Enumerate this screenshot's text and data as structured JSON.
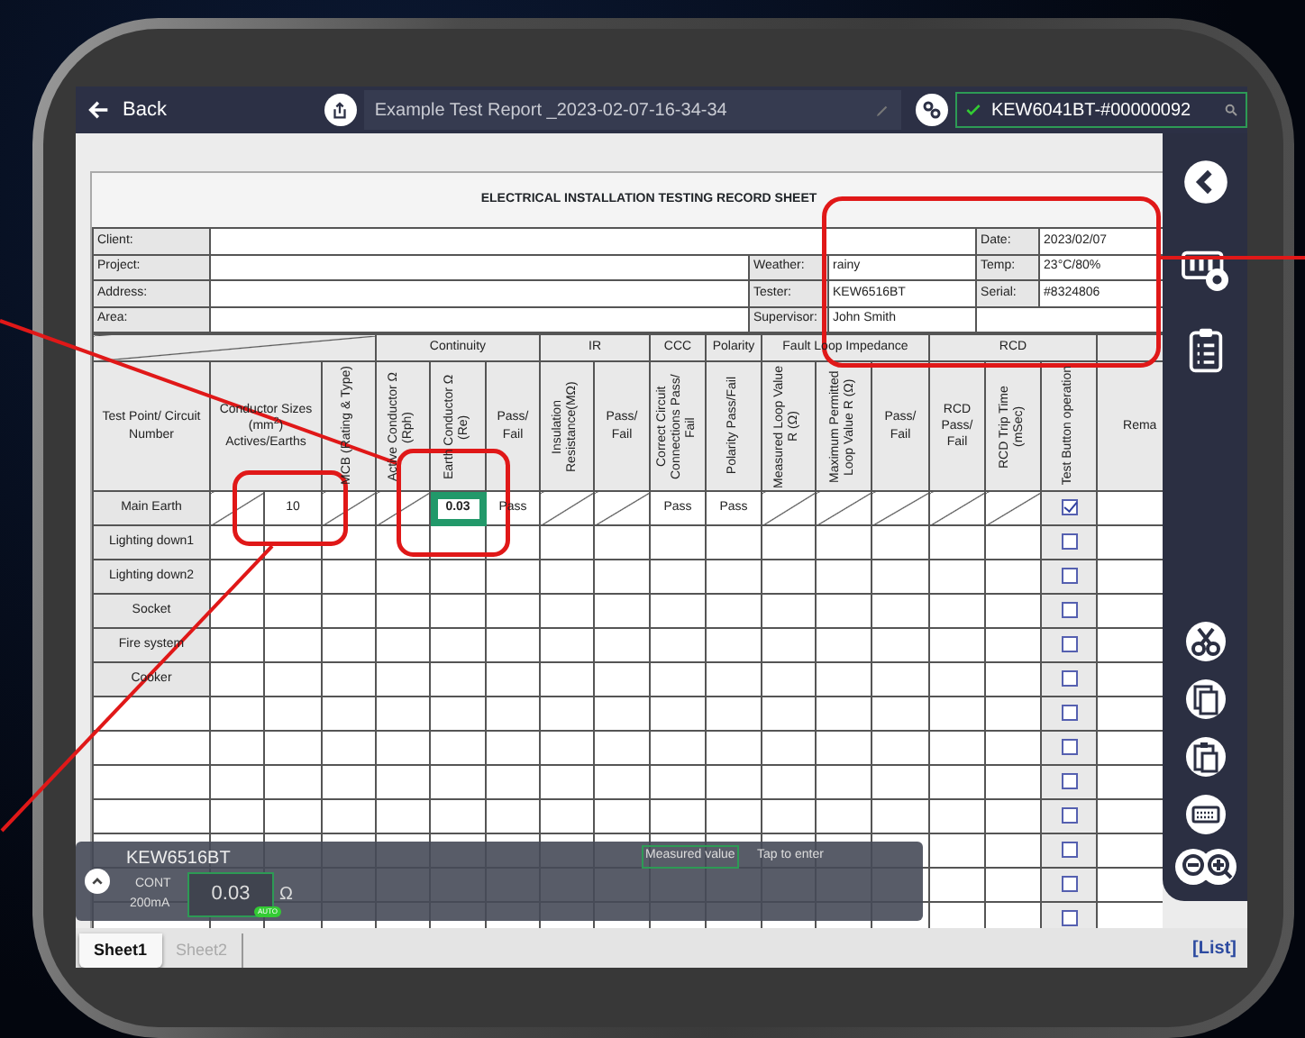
{
  "top_bar": {
    "back": "Back",
    "report_title": "Example Test Report _2023-02-07-16-34-34",
    "device": "KEW6041BT-#00000092",
    "device_connected": true
  },
  "sheet": {
    "title": "ELECTRICAL INSTALLATION TESTING RECORD SHEET",
    "info_rows": [
      [
        {
          "kind": "label",
          "text": "Client:"
        },
        {
          "kind": "blank"
        },
        {
          "kind": "blank"
        },
        {
          "kind": "blank"
        },
        {
          "kind": "label",
          "text": "Date:"
        },
        {
          "kind": "value",
          "text": "2023/02/07"
        }
      ],
      [
        {
          "kind": "label",
          "text": "Project:"
        },
        {
          "kind": "blank"
        },
        {
          "kind": "label",
          "text": "Weather:"
        },
        {
          "kind": "value",
          "text": "rainy"
        },
        {
          "kind": "label",
          "text": "Temp:"
        },
        {
          "kind": "value",
          "text": "23°C/80%"
        }
      ],
      [
        {
          "kind": "label",
          "text": "Address:"
        },
        {
          "kind": "blank"
        },
        {
          "kind": "label",
          "text": "Tester:"
        },
        {
          "kind": "value",
          "text": "KEW6516BT"
        },
        {
          "kind": "label",
          "text": "Serial:"
        },
        {
          "kind": "value",
          "text": "#8324806"
        }
      ],
      [
        {
          "kind": "label",
          "text": "Area:"
        },
        {
          "kind": "blank"
        },
        {
          "kind": "label",
          "text": "Supervisor:"
        },
        {
          "kind": "value",
          "text": "John Smith"
        },
        {
          "kind": "blank"
        },
        {
          "kind": "blank"
        }
      ]
    ],
    "column_groups": [
      {
        "columns": [
          {
            "label": "Test Point/ Circuit Number",
            "vertical": false
          },
          {
            "label": "Conductor Sizes (mm$^{2}$) Actives/Earths",
            "vertical": false,
            "kind": "pair"
          },
          {
            "label": "MCB (Rating & Type)",
            "vertical": true
          }
        ]
      },
      {
        "label": "Continuity",
        "columns": [
          {
            "label": "Active Conductor Ω (Rph)",
            "vertical": true
          },
          {
            "label": "Earth Conductor Ω (Re)",
            "vertical": true
          },
          {
            "label": "Pass/ Fail",
            "vertical": false
          }
        ]
      },
      {
        "label": "IR",
        "columns": [
          {
            "label": "Insulation Resistance(MΩ)",
            "vertical": true
          },
          {
            "label": "Pass/ Fail",
            "vertical": false
          }
        ]
      },
      {
        "label": "CCC",
        "columns": [
          {
            "label": "Correct Circuit Connections Pass/ Fail",
            "vertical": true
          }
        ]
      },
      {
        "label": "Polarity",
        "columns": [
          {
            "label": "Polarity Pass/Fail",
            "vertical": true
          }
        ]
      },
      {
        "label": "Fault Loop Impedance",
        "columns": [
          {
            "label": "Measured Loop Value R (Ω)",
            "vertical": true
          },
          {
            "label": "Maximum Permitted Loop Value R (Ω)",
            "vertical": true
          },
          {
            "label": "Pass/ Fail",
            "vertical": false
          }
        ]
      },
      {
        "label": "RCD",
        "columns": [
          {
            "label": "RCD Pass/ Fail",
            "vertical": false
          },
          {
            "label": "RCD Trip Time (mSec)",
            "vertical": true
          },
          {
            "label": "Test Button operation",
            "vertical": true
          }
        ]
      },
      {
        "columns": [
          {
            "label": "Rema",
            "vertical": false
          }
        ]
      }
    ],
    "rows": [
      {
        "point": "Main Earth",
        "checked": true,
        "cells": [
          {
            "kind": "slash"
          },
          {
            "kind": "text",
            "text": "10"
          },
          {
            "kind": "slash"
          },
          {
            "kind": "slash"
          },
          {
            "kind": "text",
            "text": "0.03",
            "highlighted": true
          },
          {
            "kind": "text",
            "text": "Pass"
          },
          {
            "kind": "slash"
          },
          {
            "kind": "slash"
          },
          {
            "kind": "text",
            "text": "Pass"
          },
          {
            "kind": "text",
            "text": "Pass"
          },
          {
            "kind": "slash"
          },
          {
            "kind": "slash"
          },
          {
            "kind": "slash"
          },
          {
            "kind": "slash"
          },
          {
            "kind": "slash"
          }
        ]
      },
      {
        "point": "Lighting down1",
        "checked": false
      },
      {
        "point": "Lighting down2",
        "checked": false
      },
      {
        "point": "Socket",
        "checked": false
      },
      {
        "point": "Fire system",
        "checked": false
      },
      {
        "point": "Cooker",
        "checked": false
      },
      {
        "checked": false
      },
      {
        "checked": false
      },
      {
        "checked": false
      },
      {
        "checked": false
      },
      {
        "checked": false
      },
      {
        "checked": false
      },
      {
        "checked": false
      }
    ]
  },
  "meter_panel": {
    "device": "KEW6516BT",
    "mode": "CONT",
    "range": "200mA",
    "value": "0.03",
    "unit": "Ω",
    "badge": "AUTO",
    "status": "Measured value",
    "hint": "Tap to enter"
  },
  "sheet_tabs": [
    {
      "label": "Sheet1",
      "selected": true
    },
    {
      "label": "Sheet2",
      "selected": false
    }
  ],
  "list_link": "[List]"
}
